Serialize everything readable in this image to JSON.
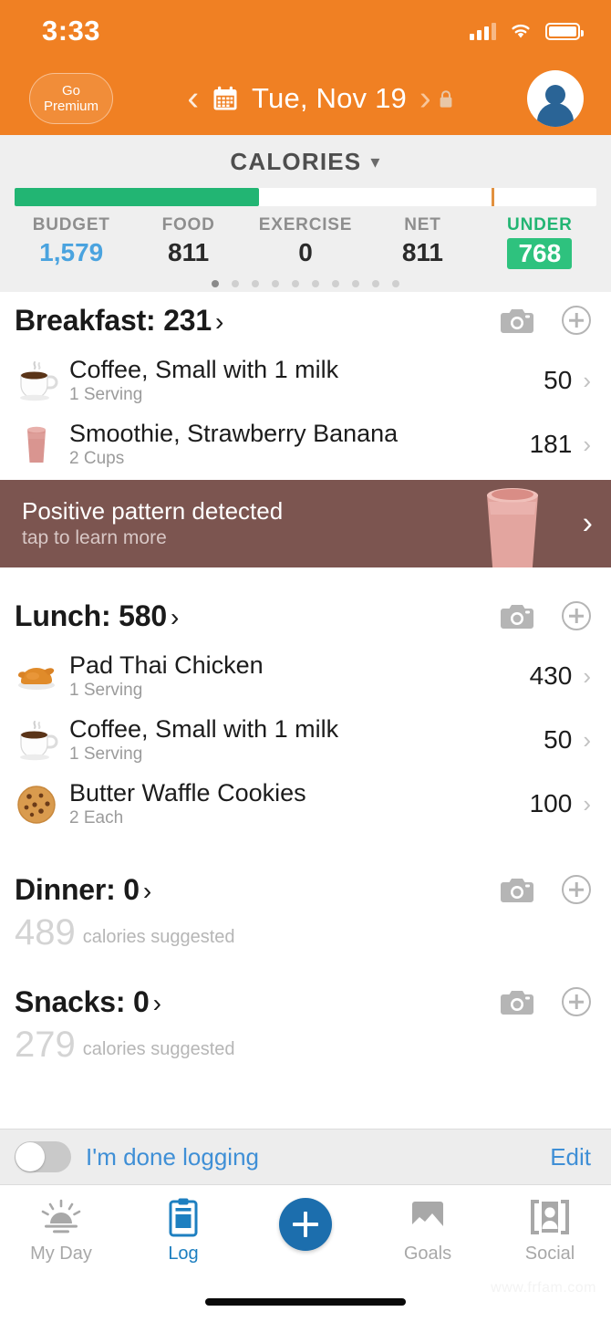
{
  "status_bar": {
    "time": "3:33"
  },
  "nav": {
    "premium_line1": "Go",
    "premium_line2": "Premium",
    "date": "Tue, Nov 19",
    "prev_icon": "chevron-left-icon",
    "next_icon": "chevron-right-icon",
    "calendar_icon": "calendar-icon",
    "lock_icon": "lock-icon",
    "avatar_icon": "profile-avatar-icon"
  },
  "summary": {
    "title": "CALORIES",
    "caret": "⌄",
    "progress_percent": 42,
    "tick_percent": 82,
    "stats": [
      {
        "label": "BUDGET",
        "value": "1,579"
      },
      {
        "label": "FOOD",
        "value": "811"
      },
      {
        "label": "EXERCISE",
        "value": "0"
      },
      {
        "label": "NET",
        "value": "811"
      },
      {
        "label": "UNDER",
        "value": "768"
      }
    ],
    "page_dots": 10,
    "active_dot": 0
  },
  "meals": [
    {
      "name": "Breakfast",
      "total": "231",
      "title": "Breakfast: 231",
      "camera_icon": "camera-icon",
      "add_icon": "add-circle-icon",
      "items": [
        {
          "icon": "coffee-cup-icon",
          "name": "Coffee, Small with 1 milk",
          "serving": "1 Serving",
          "calories": "50"
        },
        {
          "icon": "smoothie-glass-icon",
          "name": "Smoothie, Strawberry Banana",
          "serving": "2 Cups",
          "calories": "181"
        }
      ]
    },
    {
      "name": "Lunch",
      "total": "580",
      "title": "Lunch: 580",
      "camera_icon": "camera-icon",
      "add_icon": "add-circle-icon",
      "items": [
        {
          "icon": "roast-chicken-icon",
          "name": "Pad Thai Chicken",
          "serving": "1 Serving",
          "calories": "430"
        },
        {
          "icon": "coffee-cup-icon",
          "name": "Coffee, Small with 1 milk",
          "serving": "1 Serving",
          "calories": "50"
        },
        {
          "icon": "cookie-icon",
          "name": "Butter Waffle Cookies",
          "serving": "2 Each",
          "calories": "100"
        }
      ]
    },
    {
      "name": "Dinner",
      "total": "0",
      "title": "Dinner: 0",
      "camera_icon": "camera-icon",
      "add_icon": "add-circle-icon",
      "suggested_value": "489",
      "suggested_label": "calories suggested",
      "items": []
    },
    {
      "name": "Snacks",
      "total": "0",
      "title": "Snacks: 0",
      "camera_icon": "camera-icon",
      "add_icon": "add-circle-icon",
      "suggested_value": "279",
      "suggested_label": "calories suggested",
      "items": []
    }
  ],
  "insight_banner": {
    "title": "Positive pattern detected",
    "subtitle": "tap to learn more",
    "chevron": "›",
    "image_icon": "smoothie-photo-icon"
  },
  "done_bar": {
    "toggle_state": "off",
    "label": "I'm done logging",
    "edit_label": "Edit"
  },
  "tab_bar": [
    {
      "label": "My Day",
      "icon": "sunrise-icon",
      "active": false
    },
    {
      "label": "Log",
      "icon": "clipboard-icon",
      "active": true
    },
    {
      "label": "",
      "icon": "add-fab-icon",
      "active": false
    },
    {
      "label": "Goals",
      "icon": "chart-image-icon",
      "active": false
    },
    {
      "label": "Social",
      "icon": "people-brackets-icon",
      "active": false
    }
  ],
  "watermark": "www.frfam.com",
  "colors": {
    "header_orange": "#f08023",
    "progress_green": "#22b573",
    "budget_blue": "#4aa3df",
    "under_green": "#2ec27e",
    "banner_brown": "#7c5550",
    "accent_blue": "#1d7fc0"
  }
}
